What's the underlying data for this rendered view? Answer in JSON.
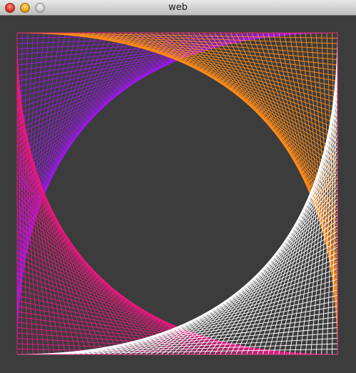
{
  "window": {
    "title": "web"
  },
  "artwork": {
    "background_color": "#3c3c3c",
    "palette": {
      "top": "#9b19e6",
      "right": "#ff8c1a",
      "bottom": "#ffffff",
      "left": "#e6197f"
    }
  }
}
